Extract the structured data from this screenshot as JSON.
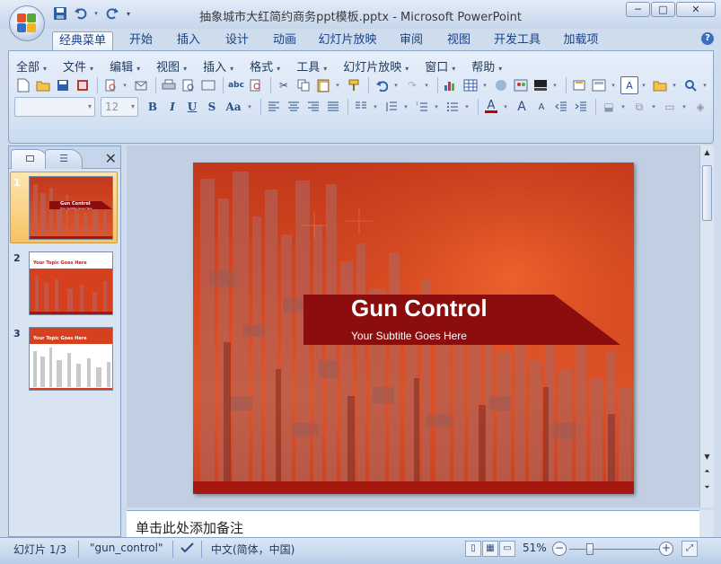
{
  "window": {
    "title": "抽象城市大红简约商务ppt模板.pptx - Microsoft PowerPoint",
    "controls": {
      "minimize": "─",
      "maximize": "□",
      "close": "✕"
    }
  },
  "quick_access": {
    "save_icon": "💾",
    "undo_icon": "↶",
    "redo_icon": "↷"
  },
  "ribbon_tabs": [
    "经典菜单",
    "开始",
    "插入",
    "设计",
    "动画",
    "幻灯片放映",
    "审阅",
    "视图",
    "开发工具",
    "加载项"
  ],
  "active_tab": "经典菜单",
  "menu": [
    "全部",
    "文件",
    "编辑",
    "视图",
    "插入",
    "格式",
    "工具",
    "幻灯片放映",
    "窗口",
    "帮助"
  ],
  "toolbar": {
    "font_name": "",
    "font_size": "12",
    "bold": "B",
    "italic": "I",
    "underline": "U",
    "strike": "S",
    "case": "Aa",
    "font_color": "A",
    "grow": "A",
    "shrink": "A",
    "textbox": "A"
  },
  "left_panel": {
    "close": "✕",
    "slides": [
      {
        "number": "1",
        "title": "Gun Control",
        "subtitle": "Your Subtitle Goes Here"
      },
      {
        "number": "2",
        "title": "Your Topic Goes Here"
      },
      {
        "number": "3",
        "title": "Your Topic Goes Here"
      }
    ]
  },
  "slide": {
    "title": "Gun Control",
    "subtitle": "Your Subtitle Goes Here"
  },
  "notes": {
    "placeholder": "单击此处添加备注"
  },
  "statusbar": {
    "slide_info": "幻灯片 1/3",
    "theme": "\"gun_control\"",
    "language": "中文(简体，中国)",
    "zoom": "51%",
    "zoom_out": "−",
    "zoom_in": "+"
  },
  "colors": {
    "slide_red": "#d94a22",
    "banner_dark": "#8b0d0d",
    "bottom_strip": "#a6170f"
  }
}
